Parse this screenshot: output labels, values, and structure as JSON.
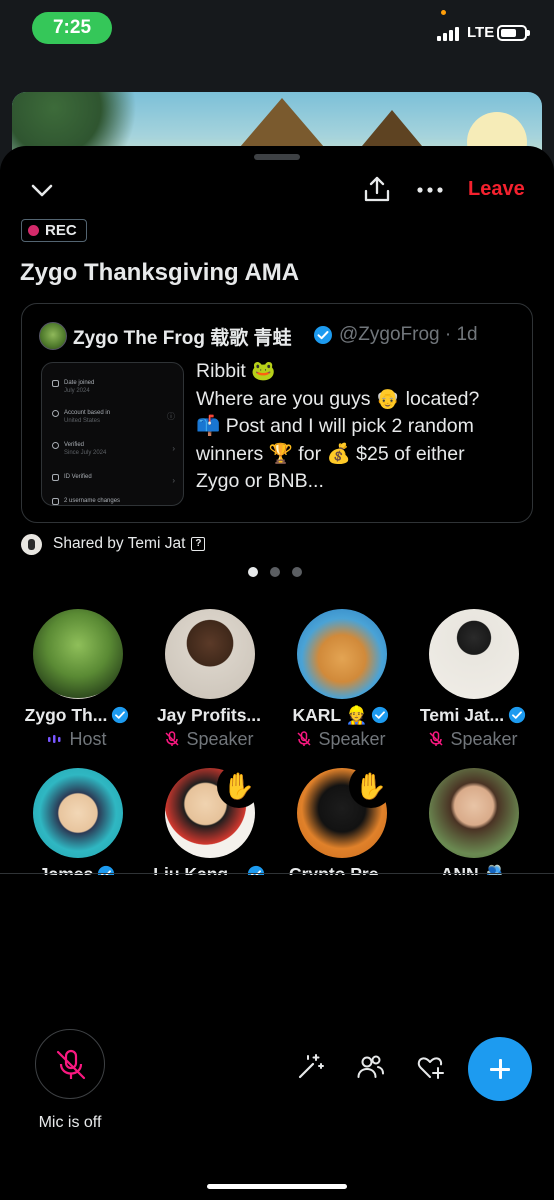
{
  "status_bar": {
    "time": "7:25",
    "network": "LTE"
  },
  "header": {
    "leave_label": "Leave"
  },
  "rec_label": "REC",
  "space_title": "Zygo Thanksgiving AMA",
  "pinned_post": {
    "author": "Zygo The Frog 载歌 青蛙",
    "handle": "@ZygoFrog · 1d",
    "text_lines": [
      "Ribbit 🐸",
      "Where are you guys 👴 located?",
      "📫 Post and I will pick 2 random",
      "winners 🏆 for 💰 $25 of either",
      "Zygo or BNB..."
    ],
    "thumbnail_rows": [
      {
        "label": "Date joined",
        "sub": "July 2024"
      },
      {
        "label": "Account based in",
        "sub": "United States"
      },
      {
        "label": "Verified",
        "sub": "Since July 2024"
      },
      {
        "label": "ID Verified",
        "sub": ""
      },
      {
        "label": "2 username changes",
        "sub": ""
      }
    ]
  },
  "shared_by": "Shared by Temi Jat",
  "pager": {
    "count": 3,
    "active": 0
  },
  "participants": [
    {
      "name": "Zygo Th...",
      "role": "Host",
      "verified": true,
      "badge": ""
    },
    {
      "name": "Jay Profits...",
      "role": "Speaker",
      "verified": false,
      "badge": ""
    },
    {
      "name": "KARL 👷",
      "role": "Speaker",
      "verified": true,
      "badge": ""
    },
    {
      "name": "Temi Jat...",
      "role": "Speaker",
      "verified": true,
      "badge": ""
    },
    {
      "name": "James",
      "role": "",
      "verified": true,
      "badge": ""
    },
    {
      "name": "Liu Kang...",
      "role": "",
      "verified": true,
      "badge": "✋"
    },
    {
      "name": "Crypto Pre...",
      "role": "",
      "verified": false,
      "badge": "✋"
    },
    {
      "name": "ANN 🫂",
      "role": "",
      "verified": false,
      "badge": ""
    }
  ],
  "controls": {
    "mic_label": "Mic is off"
  },
  "colors": {
    "accent": "#1d9bf0",
    "leave": "#f4212e",
    "rec": "#d42a6a",
    "speaker_muted": "#f91880",
    "host_bars": "#7856ff"
  }
}
